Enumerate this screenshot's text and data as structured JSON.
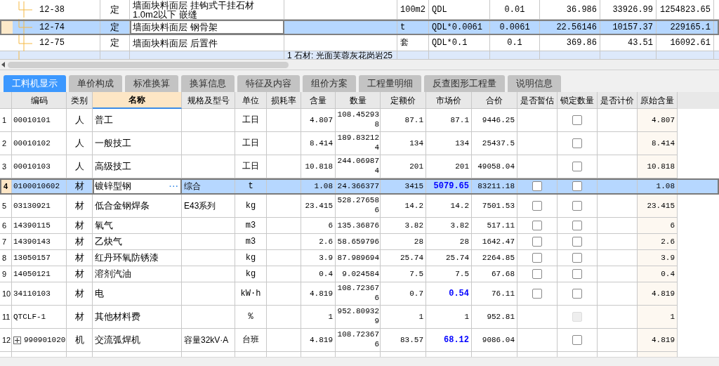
{
  "upper_table": {
    "rows": [
      {
        "code": "12-38",
        "type": "定",
        "name": "墙面块料面层 挂钩式干挂石材 1.0m2以下 嵌缝",
        "spec": "",
        "unit": "100m2",
        "qty_expr": "QDL",
        "qty": "0.01",
        "unit_price": "36.986",
        "total": "33926.99",
        "amount": "1254823.65",
        "selected": false
      },
      {
        "code": "12-74",
        "type": "定",
        "name": "墙面块料面层 钢骨架",
        "spec": "",
        "unit": "t",
        "qty_expr": "QDL*0.0061",
        "qty": "0.0061",
        "unit_price": "22.56146",
        "total": "10157.37",
        "amount": "229165.1",
        "selected": true
      },
      {
        "code": "12-75",
        "type": "定",
        "name": "墙面块料面层 后置件",
        "spec": "",
        "unit": "套",
        "qty_expr": "QDL*0.1",
        "qty": "0.1",
        "unit_price": "369.86",
        "total": "43.51",
        "amount": "16092.61",
        "selected": false
      },
      {
        "code": "",
        "type": "",
        "name": "",
        "spec": "1 石材: 光面芙蓉灰花岗岩25",
        "unit": "",
        "qty_expr": "",
        "qty": "",
        "unit_price": "",
        "total": "",
        "amount": "",
        "selected": false
      }
    ]
  },
  "tabs": [
    {
      "label": "工料机显示",
      "selected": true
    },
    {
      "label": "单价构成",
      "selected": false
    },
    {
      "label": "标准换算",
      "selected": false
    },
    {
      "label": "换算信息",
      "selected": false
    },
    {
      "label": "特征及内容",
      "selected": false
    },
    {
      "label": "组价方案",
      "selected": false
    },
    {
      "label": "工程量明细",
      "selected": false
    },
    {
      "label": "反查图形工程量",
      "selected": false
    },
    {
      "label": "说明信息",
      "selected": false
    }
  ],
  "resource_table": {
    "columns": [
      {
        "label": "编码",
        "selected": false
      },
      {
        "label": "类别",
        "selected": false
      },
      {
        "label": "名称",
        "selected": true
      },
      {
        "label": "规格及型号",
        "selected": false
      },
      {
        "label": "单位",
        "selected": false
      },
      {
        "label": "损耗率",
        "selected": false
      },
      {
        "label": "含量",
        "selected": false
      },
      {
        "label": "数量",
        "selected": false
      },
      {
        "label": "定额价",
        "selected": false
      },
      {
        "label": "市场价",
        "selected": false
      },
      {
        "label": "合价",
        "selected": false
      },
      {
        "label": "是否暂估",
        "selected": false
      },
      {
        "label": "锁定数量",
        "selected": false
      },
      {
        "label": "是否计价",
        "selected": false
      },
      {
        "label": "原始含量",
        "selected": false
      }
    ],
    "rows": [
      {
        "no": "1",
        "code": "00010101",
        "type": "人",
        "name": "普工",
        "spec": "",
        "unit": "工日",
        "content": "4.807",
        "quantity": "108.452938",
        "quota_price": "87.1",
        "market_price": "87.1",
        "market_changed": false,
        "total": "9446.25",
        "lock": {
          "checked": false,
          "disabled": false
        },
        "original": "4.807",
        "selected": false
      },
      {
        "no": "2",
        "code": "00010102",
        "type": "人",
        "name": "一般技工",
        "spec": "",
        "unit": "工日",
        "content": "8.414",
        "quantity": "189.832124",
        "quota_price": "134",
        "market_price": "134",
        "market_changed": false,
        "total": "25437.5",
        "lock": {
          "checked": false,
          "disabled": false
        },
        "original": "8.414",
        "selected": false
      },
      {
        "no": "3",
        "code": "00010103",
        "type": "人",
        "name": "高级技工",
        "spec": "",
        "unit": "工日",
        "content": "10.818",
        "quantity": "244.069874",
        "quota_price": "201",
        "market_price": "201",
        "market_changed": false,
        "total": "49058.04",
        "lock": {
          "checked": false,
          "disabled": false
        },
        "original": "10.818",
        "selected": false
      },
      {
        "no": "4",
        "code": "0100010602",
        "type": "材",
        "name": "镀锌型钢",
        "spec": "综合",
        "unit": "t",
        "content": "1.08",
        "quantity": "24.366377",
        "quota_price": "3415",
        "market_price": "5079.65",
        "market_changed": true,
        "total": "83211.18",
        "editor_button": "···",
        "estimate": {
          "checked": false
        },
        "lock": {
          "checked": false,
          "disabled": false
        },
        "original": "1.08",
        "selected": true
      },
      {
        "no": "5",
        "code": "03130921",
        "type": "材",
        "name": "低合金钢焊条",
        "spec": "E43系列",
        "unit": "kg",
        "content": "23.415",
        "quantity": "528.276586",
        "quota_price": "14.2",
        "market_price": "14.2",
        "market_changed": false,
        "total": "7501.53",
        "estimate": {
          "checked": false
        },
        "lock": {
          "checked": false,
          "disabled": false
        },
        "original": "23.415",
        "selected": false
      },
      {
        "no": "6",
        "code": "14390115",
        "type": "材",
        "name": "氧气",
        "spec": "",
        "unit": "m3",
        "content": "6",
        "quantity": "135.36876",
        "quota_price": "3.82",
        "market_price": "3.82",
        "market_changed": false,
        "total": "517.11",
        "estimate": {
          "checked": false
        },
        "lock": {
          "checked": false,
          "disabled": false
        },
        "original": "6",
        "selected": false
      },
      {
        "no": "7",
        "code": "14390143",
        "type": "材",
        "name": "乙炔气",
        "spec": "",
        "unit": "m3",
        "content": "2.6",
        "quantity": "58.659796",
        "quota_price": "28",
        "market_price": "28",
        "market_changed": false,
        "total": "1642.47",
        "estimate": {
          "checked": false
        },
        "lock": {
          "checked": false,
          "disabled": false
        },
        "original": "2.6",
        "selected": false
      },
      {
        "no": "8",
        "code": "13050157",
        "type": "材",
        "name": "红丹环氧防锈漆",
        "spec": "",
        "unit": "kg",
        "content": "3.9",
        "quantity": "87.989694",
        "quota_price": "25.74",
        "market_price": "25.74",
        "market_changed": false,
        "total": "2264.85",
        "estimate": {
          "checked": false
        },
        "lock": {
          "checked": false,
          "disabled": false
        },
        "original": "3.9",
        "selected": false
      },
      {
        "no": "9",
        "code": "14050121",
        "type": "材",
        "name": "溶剂汽油",
        "spec": "",
        "unit": "kg",
        "content": "0.4",
        "quantity": "9.024584",
        "quota_price": "7.5",
        "market_price": "7.5",
        "market_changed": false,
        "total": "67.68",
        "estimate": {
          "checked": false
        },
        "lock": {
          "checked": false,
          "disabled": false
        },
        "original": "0.4",
        "selected": false
      },
      {
        "no": "10",
        "code": "34110103",
        "type": "材",
        "name": "电",
        "spec": "",
        "unit": "kW·h",
        "content": "4.819",
        "quantity": "108.723676",
        "quota_price": "0.7",
        "market_price": "0.54",
        "market_changed": true,
        "total": "76.11",
        "estimate": {
          "checked": false
        },
        "lock": {
          "checked": false,
          "disabled": false
        },
        "original": "4.819",
        "selected": false
      },
      {
        "no": "11",
        "code": "QTCLF-1",
        "type": "材",
        "name": "其他材料费",
        "spec": "",
        "unit": "%",
        "content": "1",
        "quantity": "952.809329",
        "quota_price": "1",
        "market_price": "1",
        "market_changed": false,
        "total": "952.81",
        "lock": {
          "checked": false,
          "disabled": true
        },
        "original": "1",
        "selected": false
      },
      {
        "no": "12",
        "code": "990901020",
        "type": "机",
        "name": "交流弧焊机",
        "spec": "容量32kV·A",
        "unit": "台班",
        "content": "4.819",
        "quantity": "108.723676",
        "quota_price": "83.57",
        "market_price": "68.12",
        "market_changed": true,
        "total": "9086.04",
        "lock": {
          "checked": false,
          "disabled": false
        },
        "original": "4.819",
        "selected": false,
        "expanded": false
      }
    ]
  }
}
